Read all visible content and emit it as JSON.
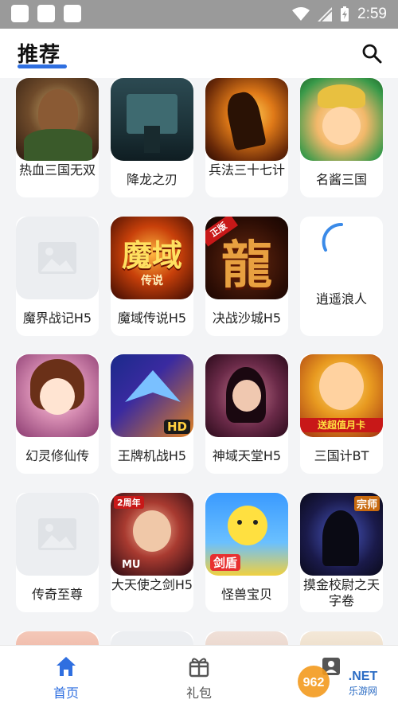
{
  "status_bar": {
    "time": "2:59"
  },
  "header": {
    "title": "推荐"
  },
  "games": [
    {
      "name": "热血三国无双"
    },
    {
      "name": "降龙之刃"
    },
    {
      "name": "兵法三十七计"
    },
    {
      "name": "名酱三国"
    },
    {
      "name": "魔界战记H5"
    },
    {
      "name": "魔域传说H5",
      "icon_text": "魔域",
      "icon_subtext": "传说"
    },
    {
      "name": "决战沙城H5",
      "icon_text": "龍",
      "icon_badge": "正版"
    },
    {
      "name": "逍遥浪人"
    },
    {
      "name": "幻灵修仙传"
    },
    {
      "name": "王牌机战H5",
      "icon_badge": "HD"
    },
    {
      "name": "神域天堂H5"
    },
    {
      "name": "三国计BT",
      "icon_badge": "送超值月卡"
    },
    {
      "name": "传奇至尊"
    },
    {
      "name": "大天使之剑H5",
      "icon_badge": "2周年",
      "icon_logo": "MU"
    },
    {
      "name": "怪兽宝贝",
      "icon_badge": "剑盾"
    },
    {
      "name": "摸金校尉之天字卷",
      "icon_badge": "宗师"
    }
  ],
  "bottom_nav": {
    "items": [
      {
        "label": "首页",
        "active": true
      },
      {
        "label": "礼包",
        "active": false
      }
    ]
  },
  "watermark": {
    "text": "962",
    "suffix": ".NET",
    "subtext": "乐游网"
  },
  "colors": {
    "accent": "#2f6fe0",
    "nav_active": "#2f6fe0",
    "nav_inactive": "#555555",
    "status_bar": "#9a9a9a"
  }
}
